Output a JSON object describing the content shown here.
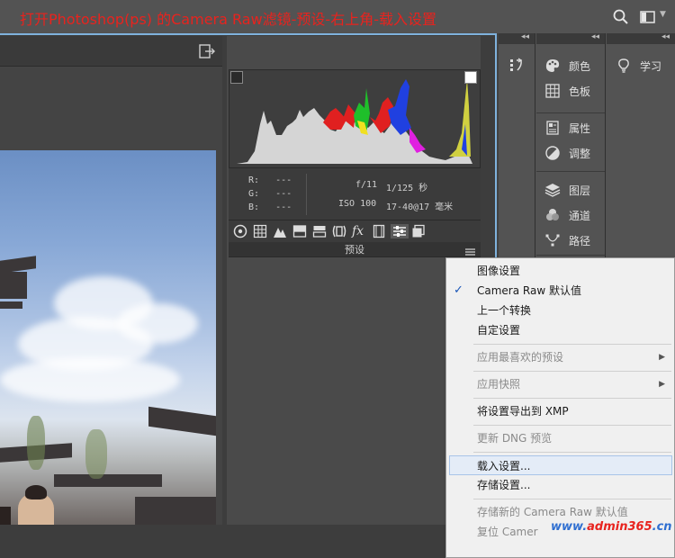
{
  "tutorial_title": "打开Photoshop(ps) 的Camera Raw滤镜-预设-右上角-载入设置",
  "readout": {
    "r_label": "R:",
    "r_value": "---",
    "g_label": "G:",
    "g_value": "---",
    "b_label": "B:",
    "b_value": "---",
    "aperture": "f/11",
    "shutter": "1/125 秒",
    "iso": "ISO 100",
    "lens": "17-40@17 毫米"
  },
  "presets_header": "预设",
  "panels": {
    "column1": [
      {
        "label": "颜色",
        "icon": "palette-icon"
      },
      {
        "label": "色板",
        "icon": "grid-icon"
      },
      {
        "label": "属性",
        "icon": "properties-icon"
      },
      {
        "label": "调整",
        "icon": "adjust-icon"
      },
      {
        "label": "图层",
        "icon": "layers-icon"
      },
      {
        "label": "通道",
        "icon": "channels-icon"
      },
      {
        "label": "路径",
        "icon": "paths-icon"
      }
    ],
    "column2": [
      {
        "label": "学习",
        "icon": "lightbulb-icon"
      }
    ]
  },
  "context_menu": {
    "items": [
      {
        "label": "图像设置",
        "enabled": true
      },
      {
        "label": "Camera Raw 默认值",
        "enabled": true,
        "checked": true
      },
      {
        "label": "上一个转换",
        "enabled": true
      },
      {
        "label": "自定设置",
        "enabled": true
      },
      {
        "label": "应用最喜欢的预设",
        "enabled": false,
        "submenu": true
      },
      {
        "label": "应用快照",
        "enabled": false,
        "submenu": true
      },
      {
        "label": "将设置导出到 XMP",
        "enabled": true
      },
      {
        "label": "更新 DNG 预览",
        "enabled": false
      },
      {
        "label": "载入设置...",
        "enabled": true,
        "highlighted": true
      },
      {
        "label": "存储设置...",
        "enabled": true
      },
      {
        "label": "存储新的 Camera Raw 默认值",
        "enabled": false
      },
      {
        "label": "复位 Camer",
        "enabled": false
      }
    ]
  },
  "watermark": {
    "part1": "www.",
    "part2": "admin365",
    "part3": ".cn",
    "color1": "#2f6fd1",
    "color2": "#e8231e"
  },
  "colors": {
    "title_red": "#e8231e",
    "dialog_border": "#7fb2dd",
    "check_blue": "#1a56b8"
  }
}
